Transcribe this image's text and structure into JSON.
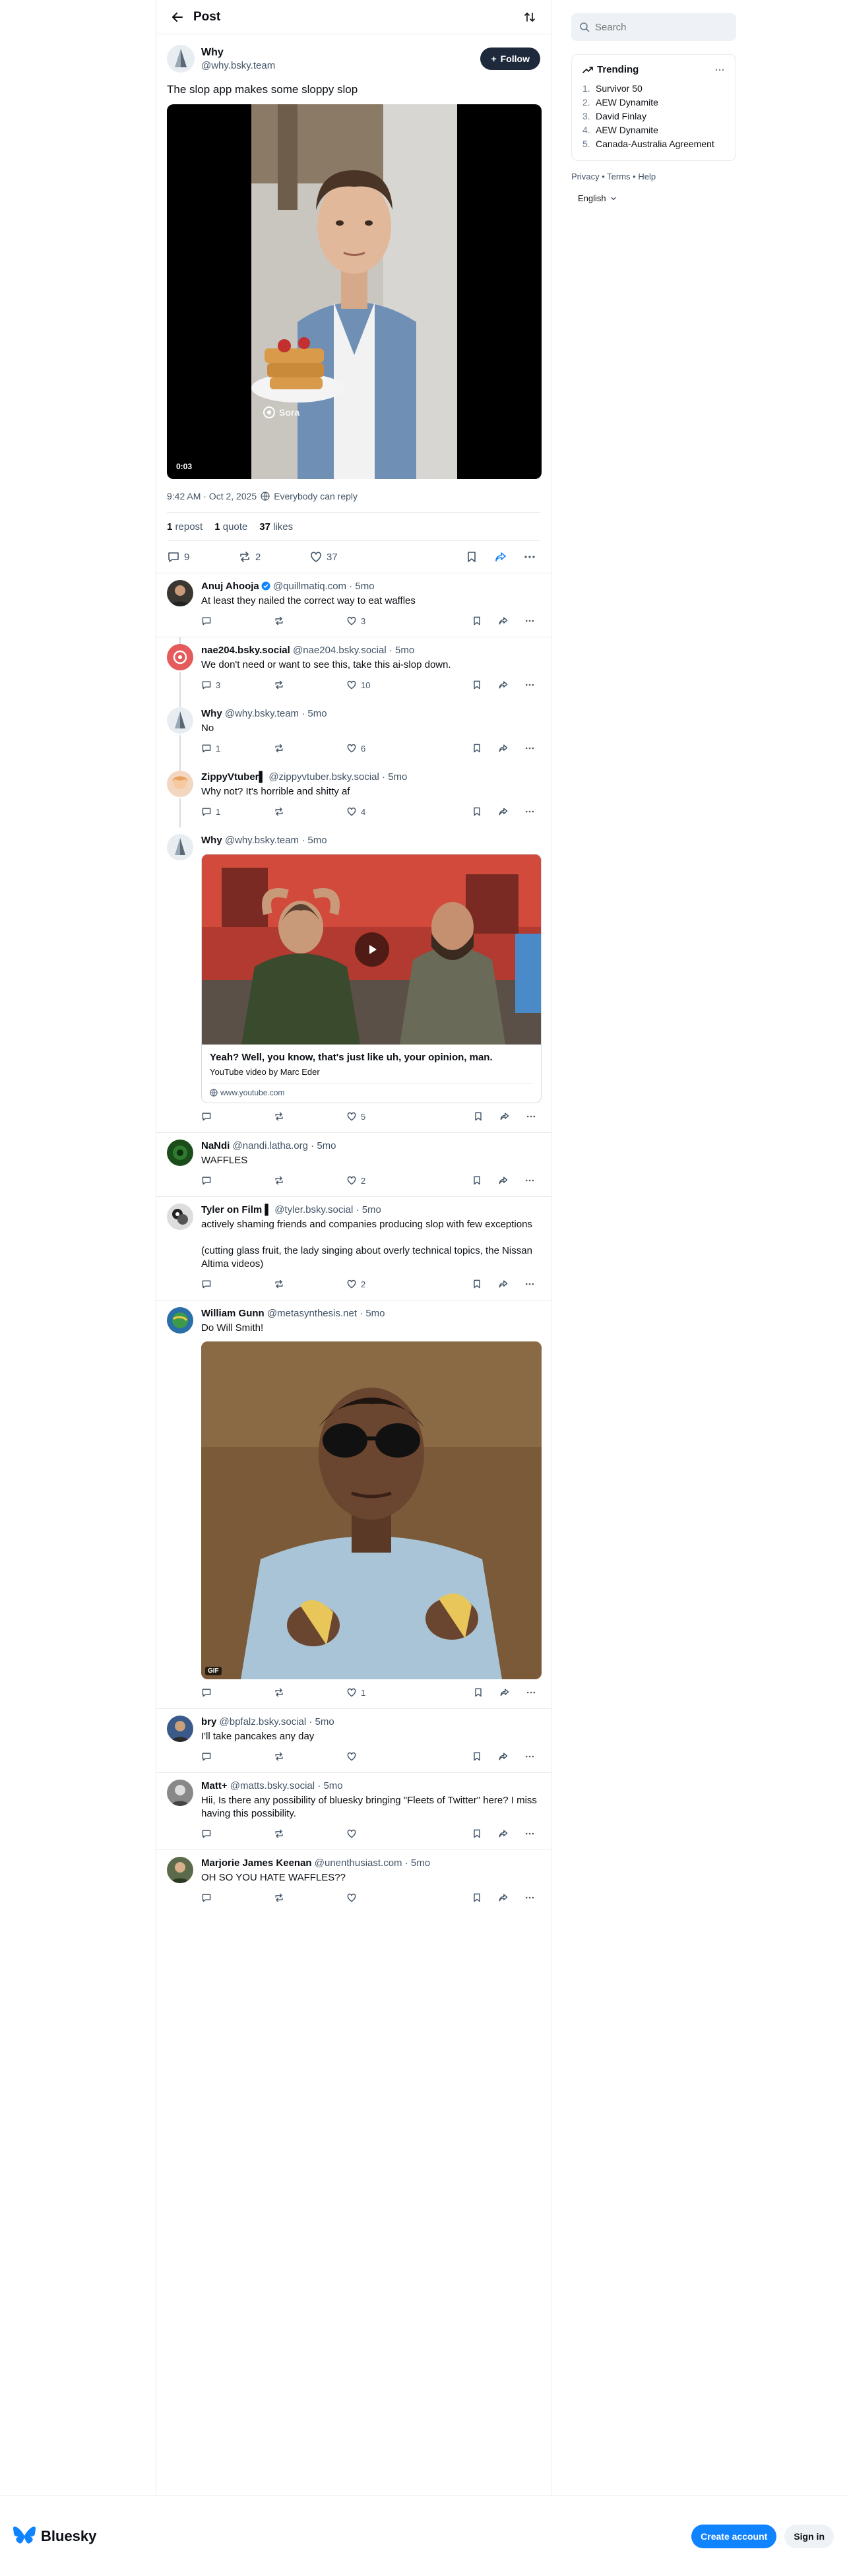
{
  "header": {
    "title": "Post"
  },
  "root_post": {
    "display_name": "Why",
    "handle": "@why.bsky.team",
    "follow_label": "Follow",
    "text": "The slop app makes some sloppy slop",
    "video_time": "0:03",
    "watermark": "Sora",
    "timestamp": "9:42 AM · Oct 2, 2025",
    "reply_setting": "Everybody can reply",
    "stats": {
      "reposts": "1",
      "reposts_label": "repost",
      "quotes": "1",
      "quotes_label": "quote",
      "likes": "37",
      "likes_label": "likes"
    },
    "actions": {
      "replies": "9",
      "reposts": "2",
      "likes": "37"
    }
  },
  "replies": [
    {
      "display_name": "Anuj Ahooja",
      "handle": "@quillmatiq.com",
      "time": "5mo",
      "text": "At least they nailed the correct way to eat waffles",
      "replies": "",
      "reposts": "",
      "likes": "3"
    },
    {
      "display_name": "nae204.bsky.social",
      "handle": "@nae204.bsky.social",
      "time": "5mo",
      "text": "We don't need or want to see this, take this ai-slop down.",
      "replies": "3",
      "reposts": "",
      "likes": "10"
    },
    {
      "display_name": "Why",
      "handle": "@why.bsky.team",
      "time": "5mo",
      "text": "No",
      "replies": "1",
      "reposts": "",
      "likes": "6"
    },
    {
      "display_name": "ZippyVtuber▌",
      "handle": "@zippyvtuber.bsky.social",
      "time": "5mo",
      "text": "Why not? It's horrible and shitty af",
      "replies": "1",
      "reposts": "",
      "likes": "4"
    },
    {
      "display_name": "Why",
      "handle": "@why.bsky.team",
      "time": "5mo",
      "text": "",
      "replies": "",
      "reposts": "",
      "likes": "5",
      "embed": {
        "title": "Yeah? Well, you know, that's just like uh, your opinion, man.",
        "description": "YouTube video by Marc Eder",
        "url": "www.youtube.com"
      }
    },
    {
      "display_name": "NaNdi",
      "handle": "@nandi.latha.org",
      "time": "5mo",
      "text": "WAFFLES",
      "replies": "",
      "reposts": "",
      "likes": "2"
    },
    {
      "display_name": "Tyler on Film ▌",
      "handle": "@tyler.bsky.social",
      "time": "5mo",
      "text": "actively shaming friends and companies producing slop with few exceptions\n\n(cutting glass fruit, the lady singing about overly technical topics, the Nissan Altima videos)",
      "replies": "",
      "reposts": "",
      "likes": "2"
    },
    {
      "display_name": "William Gunn",
      "handle": "@metasynthesis.net",
      "time": "5mo",
      "text": "Do Will Smith!",
      "replies": "",
      "reposts": "",
      "likes": "1",
      "gif_badge": "GIF"
    },
    {
      "display_name": "bry",
      "handle": "@bpfalz.bsky.social",
      "time": "5mo",
      "text": "I'll take pancakes any day",
      "replies": "",
      "reposts": "",
      "likes": ""
    },
    {
      "display_name": "Matt+",
      "handle": "@matts.bsky.social",
      "time": "5mo",
      "text": "Hii, Is there any possibility of bluesky bringing \"Fleets of Twitter\" here? I miss having this possibility.",
      "replies": "",
      "reposts": "",
      "likes": ""
    },
    {
      "display_name": "Marjorie James Keenan",
      "handle": "@unenthusiast.com",
      "time": "5mo",
      "text": "OH SO YOU HATE WAFFLES??",
      "replies": "",
      "reposts": "",
      "likes": ""
    }
  ],
  "sidebar": {
    "search_placeholder": "Search",
    "trending_title": "Trending",
    "trending": [
      {
        "n": "1.",
        "label": "Survivor 50"
      },
      {
        "n": "2.",
        "label": "AEW Dynamite"
      },
      {
        "n": "3.",
        "label": "David Finlay"
      },
      {
        "n": "4.",
        "label": "AEW Dynamite"
      },
      {
        "n": "5.",
        "label": "Canada-Australia Agreement"
      }
    ],
    "links": "Privacy • Terms • Help",
    "language": "English"
  },
  "footer": {
    "brand": "Bluesky",
    "create_label": "Create account",
    "signin_label": "Sign in"
  },
  "colors": {
    "accent": "#1083fe",
    "follow_bg": "#1e293b",
    "muted": "#425466",
    "border": "#e6ebf0"
  }
}
